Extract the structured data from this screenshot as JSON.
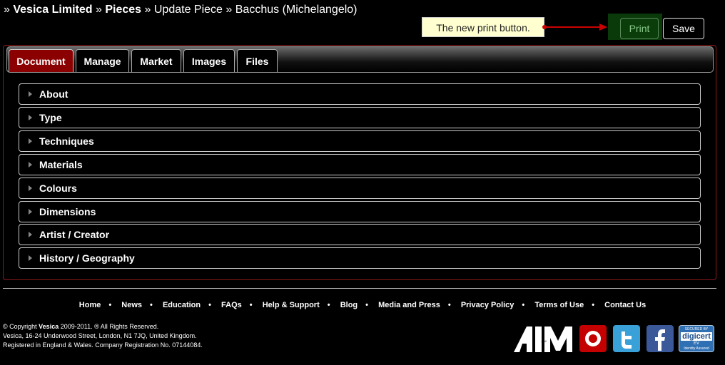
{
  "breadcrumb": {
    "sep": "»",
    "org": "Vesica Limited",
    "section": "Pieces",
    "action": "Update Piece",
    "item": "Bacchus (Michelangelo)"
  },
  "tooltip": {
    "text": "The new print button."
  },
  "buttons": {
    "print": "Print",
    "save": "Save"
  },
  "tabs": [
    {
      "label": "Document",
      "active": true
    },
    {
      "label": "Manage"
    },
    {
      "label": "Market"
    },
    {
      "label": "Images"
    },
    {
      "label": "Files"
    }
  ],
  "sections": [
    {
      "label": "About"
    },
    {
      "label": "Type"
    },
    {
      "label": "Techniques"
    },
    {
      "label": "Materials"
    },
    {
      "label": "Colours"
    },
    {
      "label": "Dimensions"
    },
    {
      "label": "Artist / Creator"
    },
    {
      "label": "History / Geography"
    }
  ],
  "footer": {
    "links": [
      "Home",
      "News",
      "Education",
      "FAQs",
      "Help & Support",
      "Blog",
      "Media and Press",
      "Privacy Policy",
      "Terms of Use",
      "Contact Us"
    ],
    "bullet": "•",
    "copyright_prefix": "© Copyright",
    "copyright_brand": "Vesica",
    "copyright_suffix": "2009-2011. ® All Rights Reserved.",
    "address": "Vesica, 16-24 Underwood Street, London, N1 7JQ, United Kingdom.",
    "registration": "Registered in England & Wales. Company Registration No. 07144084.",
    "logos": {
      "aim": "AIM",
      "digicert_top": "SECURED BY",
      "digicert_name": "digicert",
      "digicert_ev": "EV",
      "digicert_bottom": "Identity Assured"
    }
  },
  "colors": {
    "accent": "#8b0000",
    "print_bg": "#0b3d0b",
    "tooltip_bg": "#ffffd0",
    "arrow": "#cc0000"
  },
  "icons": {
    "arrow": "red-arrow-icon",
    "caret": "caret-right-icon",
    "twitter": "twitter-icon",
    "facebook": "facebook-icon"
  }
}
